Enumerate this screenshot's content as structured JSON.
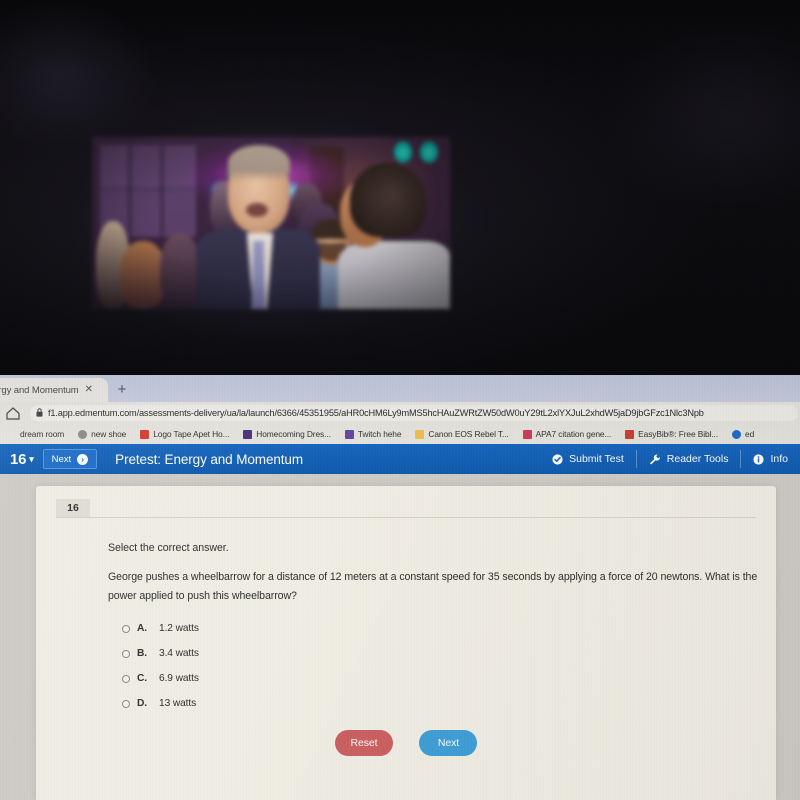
{
  "browser": {
    "tab": {
      "title": "nergy and Momentum",
      "close_label": "✕"
    },
    "new_tab_label": "+",
    "url": "f1.app.edmentum.com/assessments-delivery/ua/la/launch/6366/45351955/aHR0cHM6Ly9mMS5hcHAuZWRtZW50dW0uY29tL2xlYXJuL2xhdW5jaD9jbGFzc1Nlc3Npb",
    "bookmarks": [
      {
        "label": "dream room",
        "color": "#e9e7e0"
      },
      {
        "label": "new shoe",
        "color": "#6b6b6b"
      },
      {
        "label": "Logo Tape Apet Ho...",
        "color": "#d93a2b"
      },
      {
        "label": "Homecoming Dres...",
        "color": "#4a2f7a"
      },
      {
        "label": "Twitch hehe",
        "color": "#6441a5"
      },
      {
        "label": "Canon EOS Rebel T...",
        "color": "#f2c14a"
      },
      {
        "label": "APA7 citation gene...",
        "color": "#cf3b52"
      },
      {
        "label": "EasyBib®: Free Bibl...",
        "color": "#cf3b30"
      },
      {
        "label": "ed",
        "color": "#1a6ccb"
      }
    ]
  },
  "appbar": {
    "question_number": "16",
    "chevron": "▾",
    "next_label": "Next",
    "next_icon_glyph": "➤",
    "title": "Pretest: Energy and Momentum",
    "submit_test_label": "Submit Test",
    "reader_tools_label": "Reader Tools",
    "info_label": "Info",
    "accent_color": "#1264c0"
  },
  "question": {
    "badge": "16",
    "prompt": "Select the correct answer.",
    "stem": "George pushes a wheelbarrow for a distance of 12 meters at a constant speed for 35 seconds by applying a force of 20 newtons. What is the power applied to push this wheelbarrow?",
    "choices": [
      {
        "letter": "A.",
        "text": "1.2 watts"
      },
      {
        "letter": "B.",
        "text": "3.4 watts"
      },
      {
        "letter": "C.",
        "text": "6.9 watts"
      },
      {
        "letter": "D.",
        "text": "13 watts"
      }
    ],
    "reset_label": "Reset",
    "next_label": "Next",
    "reset_color": "#cd5f60",
    "next_color": "#3e9fd8"
  }
}
